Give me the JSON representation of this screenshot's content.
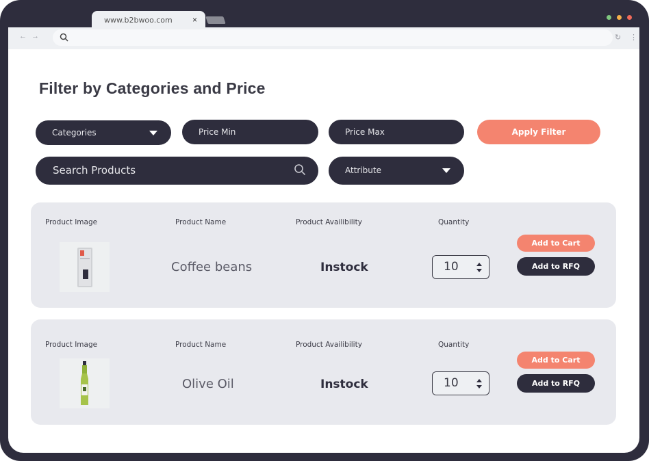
{
  "browser": {
    "tab_url": "www.b2bwoo.com",
    "tab_close": "×",
    "window_dots": [
      "#7fc77f",
      "#f5b04a",
      "#f06a5a"
    ]
  },
  "page": {
    "title": "Filter by Categories and Price"
  },
  "filters": {
    "categories_label": "Categories",
    "price_min_label": "Price Min",
    "price_max_label": "Price Max",
    "apply_label": "Apply Filter",
    "search_placeholder": "Search Products",
    "attribute_label": "Attribute"
  },
  "columns": {
    "image": "Product Image",
    "name": "Product Name",
    "availability": "Product Availibility",
    "quantity": "Quantity"
  },
  "products": [
    {
      "name": "Coffee beans",
      "availability": "Instock",
      "quantity": "10",
      "add_to_cart": "Add to Cart",
      "add_to_rfq": "Add to RFQ",
      "image_icon": "coffee-bag-icon"
    },
    {
      "name": "Olive Oil",
      "availability": "Instock",
      "quantity": "10",
      "add_to_cart": "Add to Cart",
      "add_to_rfq": "Add to RFQ",
      "image_icon": "olive-oil-bottle-icon"
    }
  ],
  "colors": {
    "frame": "#2e2d3d",
    "accent": "#f4846f",
    "card": "#e8e9ee"
  }
}
